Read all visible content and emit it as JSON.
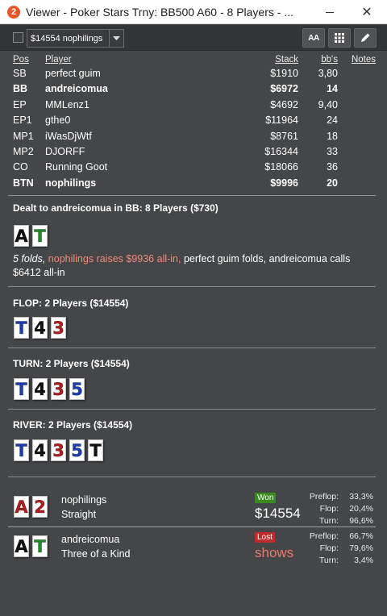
{
  "window": {
    "app_icon_text": "2",
    "title": "Viewer - Poker Stars Trny: BB500 A60 - 8 Players - ...",
    "close_glyph": "✕"
  },
  "toolbar": {
    "hand_select_value": "$14554 nophilings",
    "font_button_label": "AA"
  },
  "table": {
    "headers": {
      "pos": "Pos",
      "player": "Player",
      "stack": "Stack",
      "bbs": "bb's",
      "notes": "Notes"
    },
    "rows": [
      {
        "pos": "SB",
        "name": "perfect guim",
        "stack": "$1910",
        "bbs": "3,80",
        "bold": false
      },
      {
        "pos": "BB",
        "name": "andreicomua",
        "stack": "$6972",
        "bbs": "14",
        "bold": true
      },
      {
        "pos": "EP",
        "name": "MMLenz1",
        "stack": "$4692",
        "bbs": "9,40",
        "bold": false
      },
      {
        "pos": "EP1",
        "name": "gthe0",
        "stack": "$11964",
        "bbs": "24",
        "bold": false
      },
      {
        "pos": "MP1",
        "name": "iWasDjWtf",
        "stack": "$8761",
        "bbs": "18",
        "bold": false
      },
      {
        "pos": "MP2",
        "name": "DJORFF",
        "stack": "$16344",
        "bbs": "33",
        "bold": false
      },
      {
        "pos": "CO",
        "name": "Running Goot",
        "stack": "$18066",
        "bbs": "36",
        "bold": false
      },
      {
        "pos": "BTN",
        "name": "nophilings",
        "stack": "$9996",
        "bbs": "20",
        "bold": true
      }
    ]
  },
  "preflop": {
    "title": "Dealt to andreicomua in BB: 8 Players ($730)",
    "cards": [
      {
        "rank": "A",
        "suit": "s"
      },
      {
        "rank": "T",
        "suit": "c"
      }
    ],
    "action_folds": "5 folds,",
    "action_raise": "nophilings raises $9936 all-in,",
    "action_rest": "perfect guim folds, andreicomua calls $6412 all-in"
  },
  "flop": {
    "title": "FLOP: 2 Players ($14554)",
    "cards": [
      {
        "rank": "T",
        "suit": "d"
      },
      {
        "rank": "4",
        "suit": "s"
      },
      {
        "rank": "3",
        "suit": "h"
      }
    ]
  },
  "turn": {
    "title": "TURN: 2 Players ($14554)",
    "cards": [
      {
        "rank": "T",
        "suit": "d"
      },
      {
        "rank": "4",
        "suit": "s"
      },
      {
        "rank": "3",
        "suit": "h"
      },
      {
        "rank": "5",
        "suit": "d"
      }
    ]
  },
  "river": {
    "title": "RIVER: 2 Players ($14554)",
    "cards": [
      {
        "rank": "T",
        "suit": "d"
      },
      {
        "rank": "4",
        "suit": "s"
      },
      {
        "rank": "3",
        "suit": "h"
      },
      {
        "rank": "5",
        "suit": "d"
      },
      {
        "rank": "T",
        "suit": "s"
      }
    ]
  },
  "results": [
    {
      "cards": [
        {
          "rank": "A",
          "suit": "h"
        },
        {
          "rank": "2",
          "suit": "h"
        }
      ],
      "name": "nophilings",
      "hand": "Straight",
      "status": "Won",
      "outcome": "$14554",
      "equity": [
        {
          "label": "Preflop:",
          "value": "33,3%"
        },
        {
          "label": "Flop:",
          "value": "20,4%"
        },
        {
          "label": "Turn:",
          "value": "96,6%"
        }
      ]
    },
    {
      "cards": [
        {
          "rank": "A",
          "suit": "s"
        },
        {
          "rank": "T",
          "suit": "c"
        }
      ],
      "name": "andreicomua",
      "hand": "Three of a Kind",
      "status": "Lost",
      "outcome": "shows",
      "equity": [
        {
          "label": "Preflop:",
          "value": "66,7%"
        },
        {
          "label": "Flop:",
          "value": "79,6%"
        },
        {
          "label": "Turn:",
          "value": "3,4%"
        }
      ]
    }
  ],
  "colors": {
    "background": "#444648",
    "toolbar": "#333436",
    "raise_text": "#f08a7a",
    "won_badge": "#3a8a1e",
    "lost_badge": "#c02a2a",
    "spade": "#111111",
    "club": "#1e8a2a",
    "heart": "#b01d1d",
    "diamond": "#1a3cb0"
  }
}
